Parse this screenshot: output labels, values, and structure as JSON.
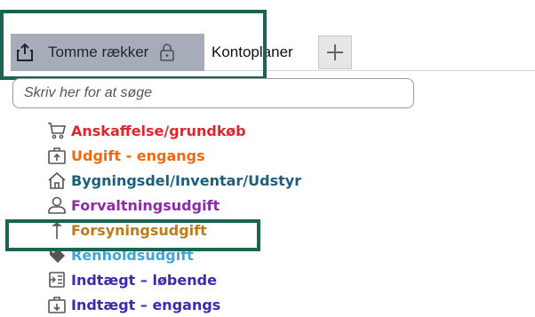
{
  "tabs": {
    "active_label": "Tomme rækker",
    "second_label": "Kontoplaner",
    "add_symbol": "+"
  },
  "search": {
    "placeholder": "Skriv her for at søge"
  },
  "items": [
    {
      "label": "Anskaffelse/grundkøb",
      "color": "#e0262b",
      "icon": "cart-icon"
    },
    {
      "label": "Udgift - engangs",
      "color": "#ee6a10",
      "icon": "box-up-icon"
    },
    {
      "label": "Bygningsdel/Inventar/Udstyr",
      "color": "#1b5e7e",
      "icon": "house-icon"
    },
    {
      "label": "Forvaltningsudgift",
      "color": "#8c2aa9",
      "icon": "person-icon"
    },
    {
      "label": "Forsyningsudgift",
      "color": "#bd7a1a",
      "icon": "tap-icon"
    },
    {
      "label": "Renholdsudgift",
      "color": "#3ea7d6",
      "icon": "tag-icon"
    },
    {
      "label": "Indtægt – løbende",
      "color": "#3a2bb0",
      "icon": "list-in-icon"
    },
    {
      "label": "Indtægt – engangs",
      "color": "#3a2bb0",
      "icon": "box-down-icon"
    }
  ]
}
